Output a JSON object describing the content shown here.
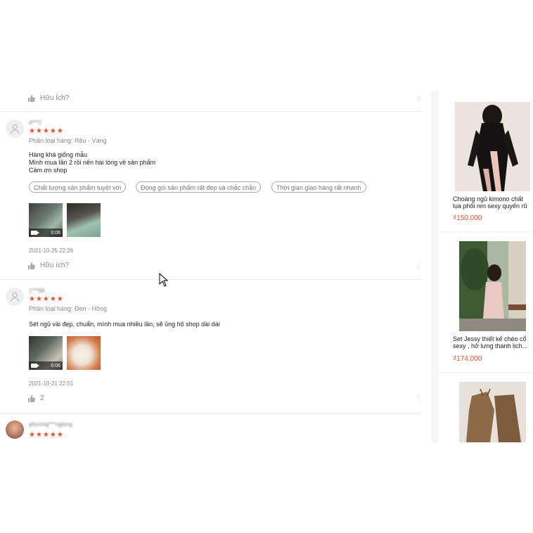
{
  "reviews": [
    {
      "username": "d***2",
      "rating": 5,
      "stars_text": "★★★★★",
      "variant": "Phân loại hàng: Rêu - Vàng",
      "body_lines": [
        "Hàng khá giống mẫu",
        "Mình mua lần 2 rồi nên hài lòng về sản phẩm",
        "Cảm ơn shop"
      ],
      "tags": [
        "Chất lượng sản phẩm tuyệt vời",
        "Đóng gói sản phẩm rất đẹp và chắc chắn",
        "Thời gian giao hàng rất nhanh"
      ],
      "video_duration": "0:06",
      "date": "2021-10-25 22:26",
      "helpful": "Hữu ích?"
    },
    {
      "username": "1***66",
      "rating": 5,
      "stars_text": "★★★★★",
      "variant": "Phân loại hàng: Đen - Hồng",
      "body_lines": [
        "Sét ngủ vải đẹp, chuẩn, mình mua nhiều lần, sẽ ủng hộ shop dài dài"
      ],
      "video_duration": "0:06",
      "date": "2021-10-21 22:51",
      "likes": "2"
    },
    {
      "username": "phương***nglong",
      "rating": 5,
      "stars_text": "★★★★★"
    }
  ],
  "top_helpful": "Hữu Ích?",
  "products": [
    {
      "name": "Choàng ngủ kimono chất lụa phối ren sexy quyến rũ",
      "price": "₫150.000"
    },
    {
      "name": "Set Jessy thiết kế chéo cổ sexy , hở lưng thanh lịch...",
      "price": "₫174.000"
    }
  ],
  "colors": {
    "accent": "#ee4d2d"
  }
}
